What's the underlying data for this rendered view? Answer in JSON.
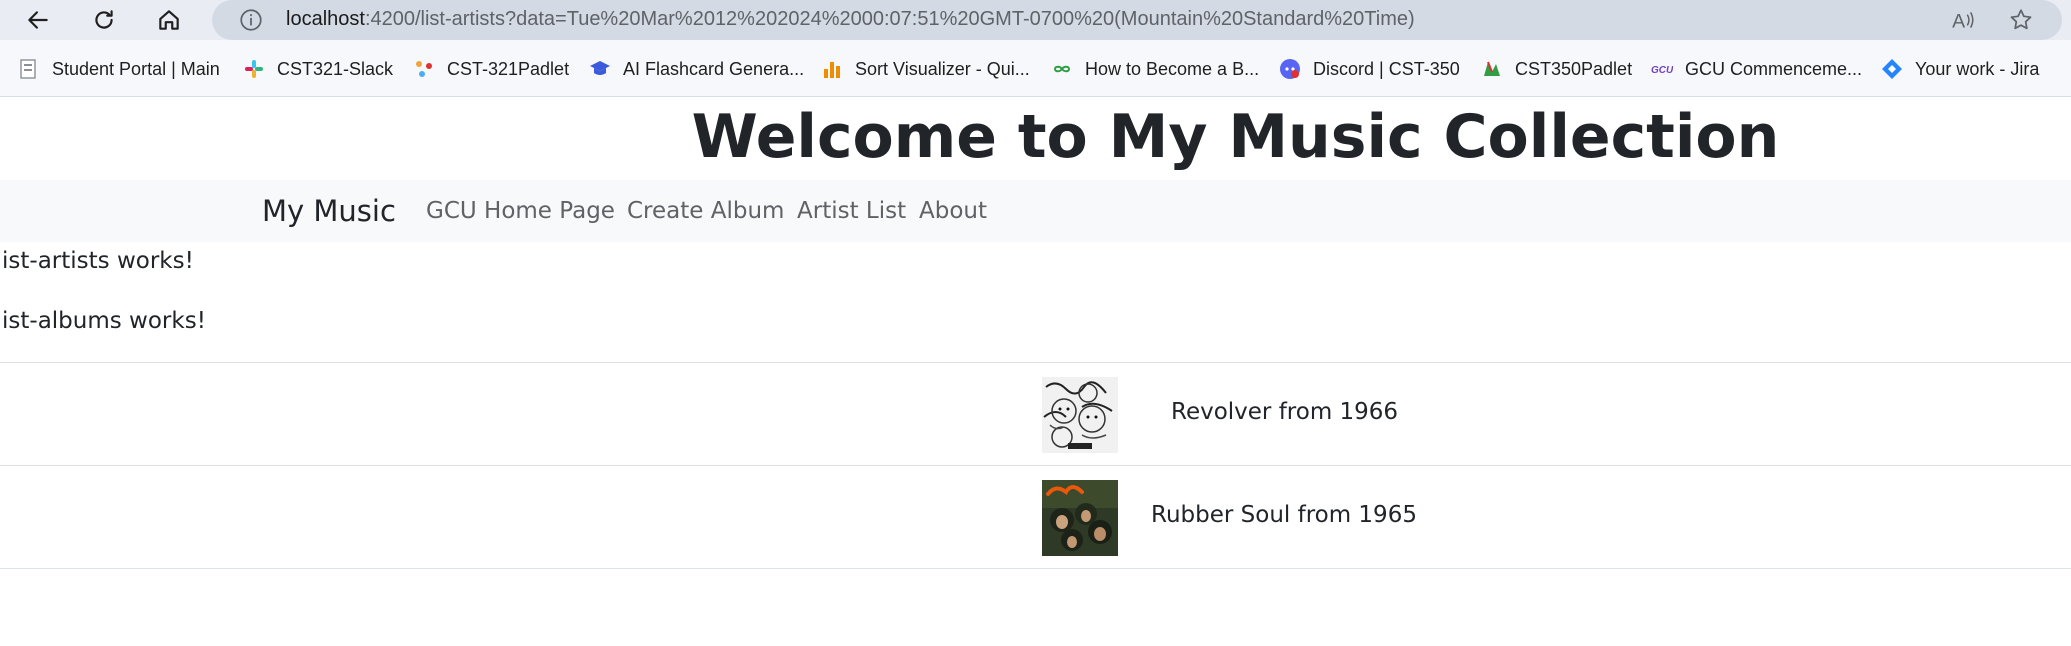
{
  "browser": {
    "url_host": "localhost",
    "url_rest": ":4200/list-artists?data=Tue%20Mar%2012%202024%2000:07:51%20GMT-0700%20(Mountain%20Standard%20Time)",
    "icons": [
      "back-arrow-icon",
      "reload-icon",
      "home-icon",
      "info-icon",
      "read-aloud-icon",
      "favorite-star-icon"
    ]
  },
  "bookmarks": [
    {
      "label": "Student Portal | Main",
      "icon": "portal-icon",
      "color": "#8a8f98"
    },
    {
      "label": "CST321-Slack",
      "icon": "slack-icon",
      "color": "#e01e5a"
    },
    {
      "label": "CST-321Padlet",
      "icon": "padlet-icon",
      "color": "#f2a33a"
    },
    {
      "label": "AI Flashcard Genera...",
      "icon": "graduation-cap-icon",
      "color": "#3b5bdb"
    },
    {
      "label": "Sort Visualizer - Qui...",
      "icon": "bar-chart-icon",
      "color": "#f08c00"
    },
    {
      "label": "How to Become a B...",
      "icon": "infinity-icon",
      "color": "#2f9e44"
    },
    {
      "label": "Discord | CST-350",
      "icon": "discord-icon",
      "color": "#5865f2"
    },
    {
      "label": "CST350Padlet",
      "icon": "padlet-icon",
      "color": "#f2a33a"
    },
    {
      "label": "GCU Commenceme...",
      "icon": "gcu-icon",
      "color": "#6f42c1"
    },
    {
      "label": "Your work - Jira",
      "icon": "jira-icon",
      "color": "#2684ff"
    }
  ],
  "header": {
    "title": "Welcome to My Music Collection"
  },
  "navbar": {
    "brand": "My Music",
    "links": [
      "GCU Home Page",
      "Create Album",
      "Artist List",
      "About"
    ]
  },
  "main": {
    "artists_works": "ist-artists works!",
    "albums_works": "ist-albums works!",
    "albums": [
      {
        "label": "Revolver from 1966"
      },
      {
        "label": "Rubber Soul from 1965"
      }
    ]
  }
}
